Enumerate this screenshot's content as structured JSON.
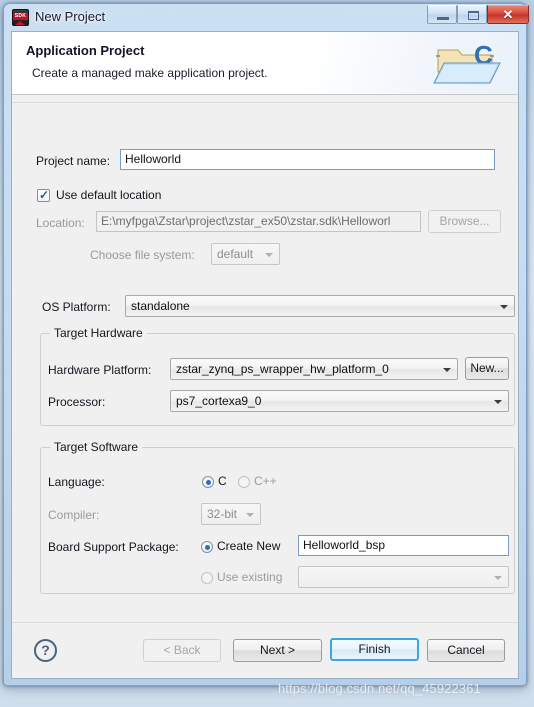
{
  "window": {
    "title": "New Project",
    "icon": "sdk-icon",
    "icon_text": "SDK",
    "controls": {
      "minimize": "minimize-icon",
      "maximize": "maximize-icon",
      "close": "✕"
    }
  },
  "banner": {
    "title": "Application Project",
    "subtitle": "Create a managed make application project.",
    "icon": "folder-c-icon"
  },
  "form": {
    "project_name": {
      "label": "Project name:",
      "value": "Helloworld"
    },
    "use_default_location": {
      "label": "Use default location",
      "checked": true
    },
    "location": {
      "label": "Location:",
      "value": "E:\\myfpga\\Zstar\\project\\zstar_ex50\\zstar.sdk\\Helloworl",
      "browse_label": "Browse...",
      "disabled": true
    },
    "file_system": {
      "label": "Choose file system:",
      "value": "default",
      "disabled": true
    },
    "os_platform": {
      "label": "OS Platform:",
      "value": "standalone"
    },
    "target_hardware": {
      "legend": "Target Hardware",
      "hardware_platform": {
        "label": "Hardware Platform:",
        "value": "zstar_zynq_ps_wrapper_hw_platform_0",
        "new_label": "New..."
      },
      "processor": {
        "label": "Processor:",
        "value": "ps7_cortexa9_0"
      }
    },
    "target_software": {
      "legend": "Target Software",
      "language": {
        "label": "Language:",
        "options": [
          "C",
          "C++"
        ],
        "selected": "C"
      },
      "compiler": {
        "label": "Compiler:",
        "value": "32-bit",
        "disabled": true
      },
      "bsp": {
        "label": "Board Support Package:",
        "create_new_label": "Create New",
        "create_new_selected": true,
        "create_new_value": "Helloworld_bsp",
        "use_existing_label": "Use existing",
        "use_existing_selected": false,
        "use_existing_value": ""
      }
    }
  },
  "footer": {
    "help": "?",
    "back": "< Back",
    "next": "Next >",
    "finish": "Finish",
    "cancel": "Cancel"
  },
  "watermark": "https://blog.csdn.net/qq_45922361"
}
